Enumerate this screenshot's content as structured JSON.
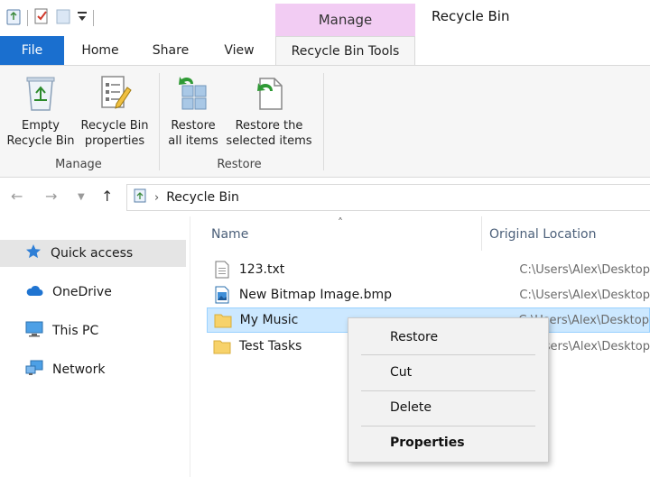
{
  "window": {
    "title": "Recycle Bin",
    "context_tab_group": "Manage"
  },
  "tabs": [
    {
      "label": "File"
    },
    {
      "label": "Home"
    },
    {
      "label": "Share"
    },
    {
      "label": "View"
    },
    {
      "label": "Recycle Bin Tools"
    }
  ],
  "ribbon": {
    "groups": [
      {
        "label": "Manage",
        "buttons": [
          {
            "line1": "Empty",
            "line2": "Recycle Bin",
            "icon": "recycle-bin-icon"
          },
          {
            "line1": "Recycle Bin",
            "line2": "properties",
            "icon": "properties-icon"
          }
        ]
      },
      {
        "label": "Restore",
        "buttons": [
          {
            "line1": "Restore",
            "line2": "all items",
            "icon": "restore-all-icon"
          },
          {
            "line1": "Restore the",
            "line2": "selected items",
            "icon": "restore-selected-icon"
          }
        ]
      }
    ]
  },
  "address": {
    "path": "Recycle Bin"
  },
  "nav": {
    "items": [
      {
        "label": "Quick access",
        "icon": "star-icon",
        "selected": true
      },
      {
        "label": "OneDrive",
        "icon": "cloud-icon",
        "selected": false
      },
      {
        "label": "This PC",
        "icon": "monitor-icon",
        "selected": false
      },
      {
        "label": "Network",
        "icon": "network-icon",
        "selected": false
      }
    ]
  },
  "columns": {
    "name": "Name",
    "original_location": "Original Location"
  },
  "files": [
    {
      "name": "123.txt",
      "location": "C:\\Users\\Alex\\Desktop",
      "icon": "text-file-icon",
      "selected": false
    },
    {
      "name": "New Bitmap Image.bmp",
      "location": "C:\\Users\\Alex\\Desktop",
      "icon": "bitmap-file-icon",
      "selected": false
    },
    {
      "name": "My Music",
      "location": "C:\\Users\\Alex\\Desktop",
      "icon": "folder-icon",
      "selected": true
    },
    {
      "name": "Test Tasks",
      "location": "C:\\Users\\Alex\\Desktop",
      "icon": "folder-icon",
      "selected": false
    }
  ],
  "context_menu": {
    "items": [
      {
        "label": "Restore"
      },
      {
        "label": "Cut"
      },
      {
        "label": "Delete"
      },
      {
        "label": "Properties"
      }
    ]
  },
  "colors": {
    "file_tab": "#1a6fcf",
    "context_tab": "#f2ccf3",
    "selection": "#cce8ff",
    "folder": "#f7d26a"
  }
}
